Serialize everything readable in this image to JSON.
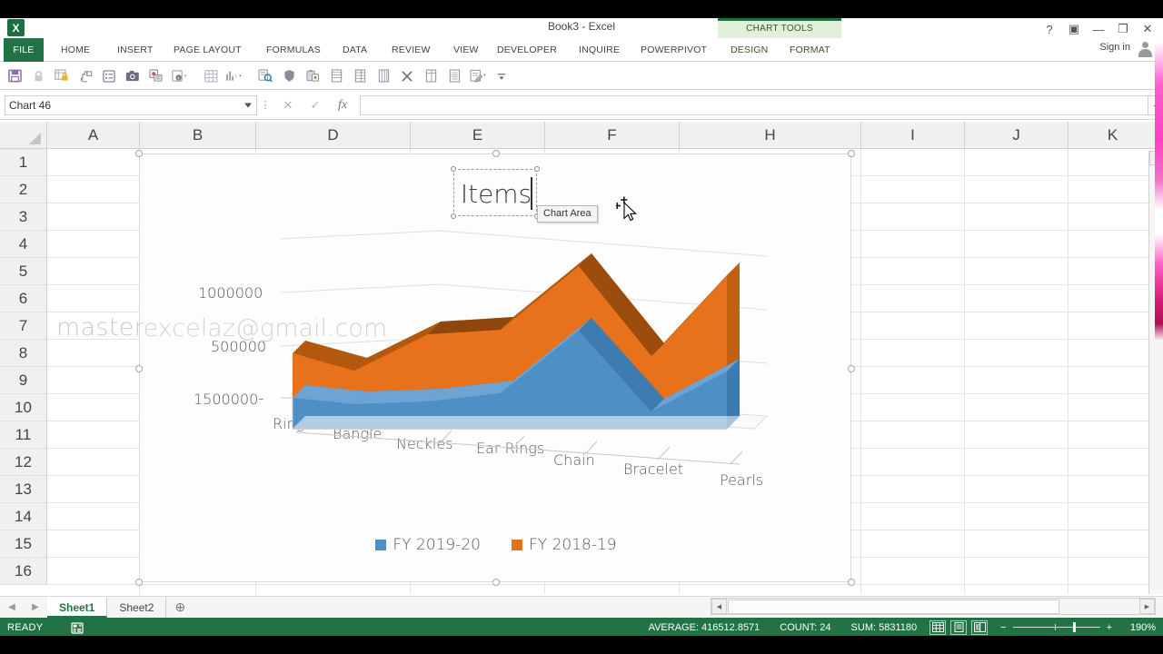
{
  "window": {
    "title": "Book3 - Excel",
    "app_icon": "excel-logo-icon",
    "help_label": "?",
    "ribbon_display_label": "▣",
    "minimize_label": "—",
    "restore_label": "❐",
    "close_label": "✕",
    "signin_label": "Sign in"
  },
  "ribbon": {
    "tabs": [
      {
        "label": "FILE"
      },
      {
        "label": "HOME"
      },
      {
        "label": "INSERT"
      },
      {
        "label": "PAGE LAYOUT"
      },
      {
        "label": "FORMULAS"
      },
      {
        "label": "DATA"
      },
      {
        "label": "REVIEW"
      },
      {
        "label": "VIEW"
      },
      {
        "label": "DEVELOPER"
      },
      {
        "label": "INQUIRE"
      },
      {
        "label": "POWERPIVOT"
      }
    ],
    "contextual_group": "CHART TOOLS",
    "contextual_tabs": [
      {
        "label": "DESIGN"
      },
      {
        "label": "FORMAT"
      }
    ]
  },
  "quick_access_toolbar": {
    "items": [
      {
        "name": "save-icon"
      },
      {
        "name": "lock-icon"
      },
      {
        "name": "protect-sheet-icon"
      },
      {
        "name": "hand-stamp-icon"
      },
      {
        "name": "form-icon"
      },
      {
        "name": "camera-icon"
      },
      {
        "name": "speaker-notes-icon"
      },
      {
        "name": "info-dropdown-icon"
      },
      {
        "name": "spreadsheet-grid-icon"
      },
      {
        "name": "chart-dropdown-icon"
      },
      {
        "name": "find-icon"
      },
      {
        "name": "shield-icon"
      },
      {
        "name": "paste-special-icon"
      },
      {
        "name": "sheet-icon"
      },
      {
        "name": "sheet-column-icon"
      },
      {
        "name": "table-icon"
      },
      {
        "name": "close-x-icon"
      },
      {
        "name": "sheet-list-icon"
      },
      {
        "name": "list-icon"
      },
      {
        "name": "edit-dropdown-icon"
      },
      {
        "name": "customize-qat-icon"
      }
    ]
  },
  "formula_bar": {
    "name_box_value": "Chart 46",
    "cancel_label": "✕",
    "enter_label": "✓",
    "fx_label": "fx",
    "input_value": "",
    "expand_label": "⌄"
  },
  "grid": {
    "columns": [
      "A",
      "B",
      "D",
      "E",
      "F",
      "H",
      "I",
      "J",
      "K"
    ],
    "rows": [
      "1",
      "2",
      "3",
      "4",
      "5",
      "6",
      "7",
      "8",
      "9",
      "10",
      "11",
      "12",
      "13",
      "14",
      "15",
      "16"
    ],
    "watermark": "masterexcelaz@gmail.com"
  },
  "chart": {
    "title": "Items",
    "tooltip": "Chart Area",
    "selected": true
  },
  "chart_data": {
    "type": "area",
    "subtype": "3d-stacked-area",
    "title": "Items",
    "categories": [
      "Rings",
      "Bangle",
      "Neckles",
      "Ear Rings",
      "Chain",
      "Bracelet",
      "Pearls"
    ],
    "series": [
      {
        "name": "FY 2019-20",
        "color": "#4E8FC6",
        "values": [
          165000,
          120000,
          135000,
          150000,
          430000,
          120000,
          470000
        ]
      },
      {
        "name": "FY 2018-19",
        "color": "#E8721C",
        "values": [
          275000,
          165000,
          500000,
          540000,
          930000,
          360000,
          800000
        ]
      }
    ],
    "xlabel": "",
    "ylabel": "",
    "ylim": [
      0,
      1500000
    ],
    "yticks": [
      "-",
      "500000",
      "1000000",
      "1500000"
    ],
    "ytick_values": [
      0,
      500000,
      1000000,
      1500000
    ],
    "legend_position": "bottom",
    "grid": true
  },
  "sheet_tabs": {
    "prev_label": "◀",
    "next_label": "▶",
    "tabs": [
      {
        "label": "Sheet1",
        "active": true
      },
      {
        "label": "Sheet2",
        "active": false
      }
    ],
    "add_label": "⊕"
  },
  "scrollbars": {
    "h_left_label": "◀",
    "h_right_label": "▶",
    "v_up_label": "▲",
    "v_down_label": "▼"
  },
  "status_bar": {
    "mode": "READY",
    "macro_record_icon": "record-macro-icon",
    "average": "AVERAGE: 416512.8571",
    "count": "COUNT: 24",
    "sum": "SUM: 5831180",
    "view_normal_icon": "normal-view-icon",
    "view_layout_icon": "page-layout-view-icon",
    "view_break_icon": "page-break-view-icon",
    "zoom_out_label": "−",
    "zoom_in_label": "+",
    "zoom_level": "190%"
  },
  "colors": {
    "accent_green": "#217346",
    "series_blue": "#4E8FC6",
    "series_orange": "#E8721C",
    "contextual_green": "#e2efda"
  }
}
